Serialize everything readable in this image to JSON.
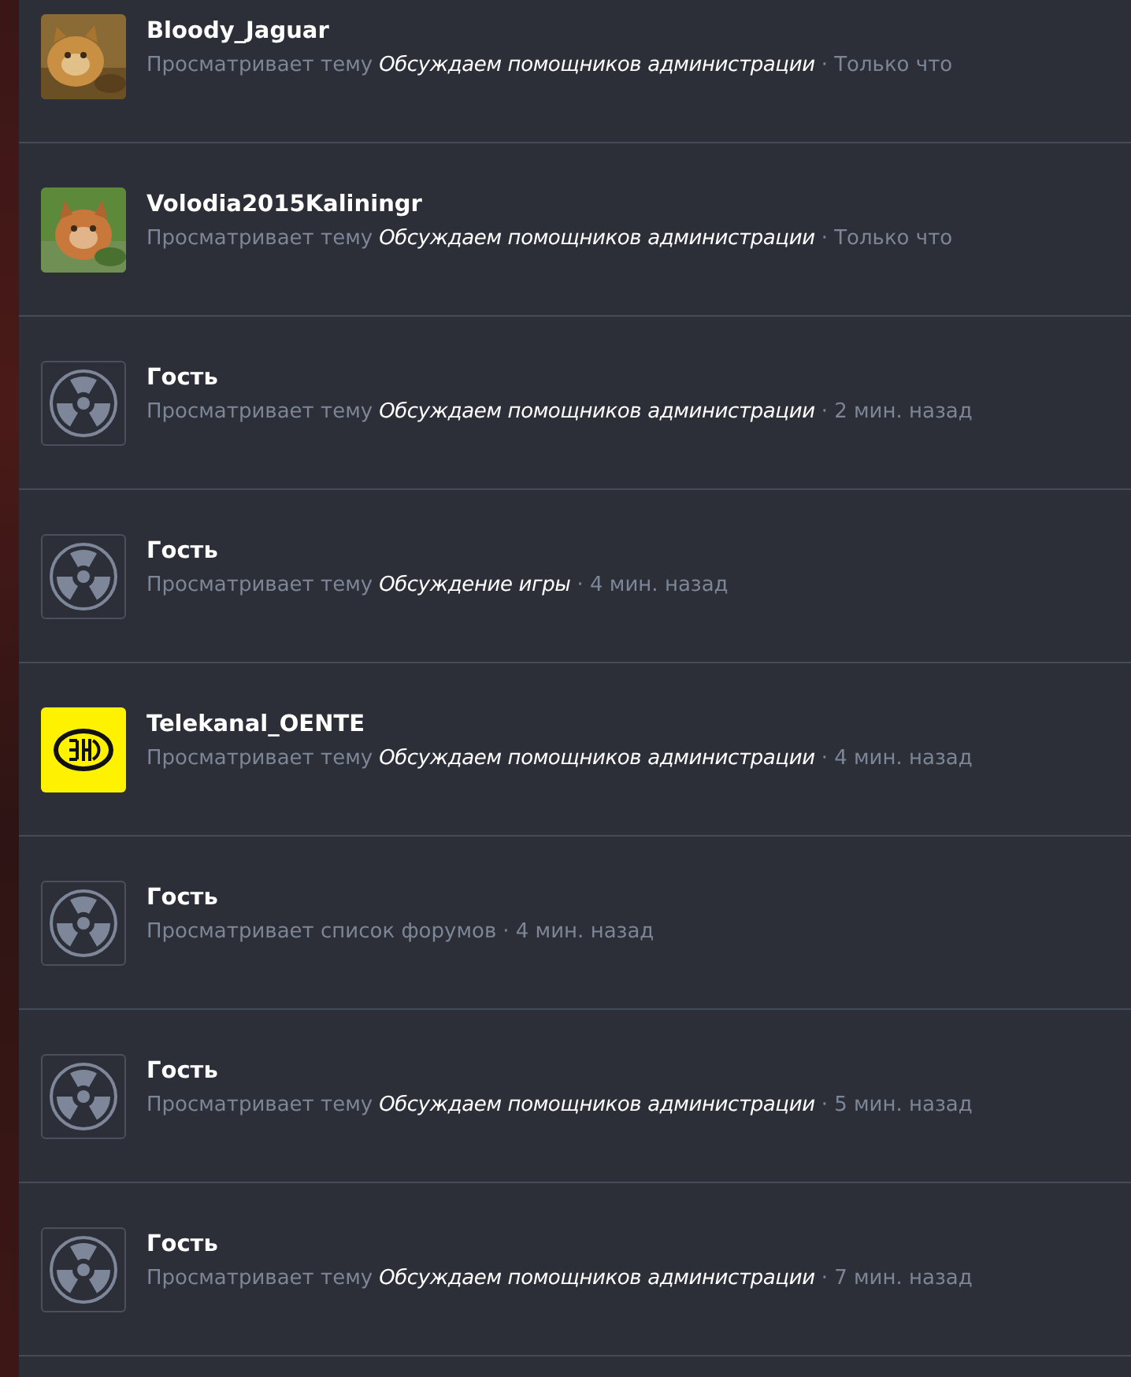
{
  "visitors": [
    {
      "name": "Bloody_Jaguar",
      "action": "Просматривает тему",
      "topic": "Обсуждаем помощников администрации",
      "time": "· Только что"
    },
    {
      "name": "Volodia2015Kaliningr",
      "action": "Просматривает тему",
      "topic": "Обсуждаем помощников администрации",
      "time": "· Только что"
    },
    {
      "name": "Гость",
      "avatar": {
        "kind": "guest"
      },
      "action": "Просматривает тему",
      "topic": "Обсуждаем помощников администрации",
      "time": "· 2 мин. назад"
    },
    {
      "name": "Гость",
      "avatar": {
        "kind": "guest"
      },
      "action": "Просматривает тему",
      "topic": "Обсуждение игры",
      "time": "· 4 мин. назад"
    },
    {
      "name": "Telekanal_OENTE",
      "avatar": {
        "kind": "logo"
      },
      "action": "Просматривает тему",
      "topic": "Обсуждаем помощников администрации",
      "time": "· 4 мин. назад"
    },
    {
      "name": "Гость",
      "avatar": {
        "kind": "guest"
      },
      "action": "Просматривает список форумов",
      "time": "· 4 мин. назад"
    },
    {
      "name": "Гость",
      "avatar": {
        "kind": "guest"
      },
      "action": "Просматривает тему",
      "topic": "Обсуждаем помощников администрации",
      "time": "· 5 мин. назад"
    },
    {
      "name": "Гость",
      "avatar": {
        "kind": "guest"
      },
      "action": "Просматривает тему",
      "topic": "Обсуждаем помощников администрации",
      "time": "· 7 мин. назад"
    }
  ]
}
